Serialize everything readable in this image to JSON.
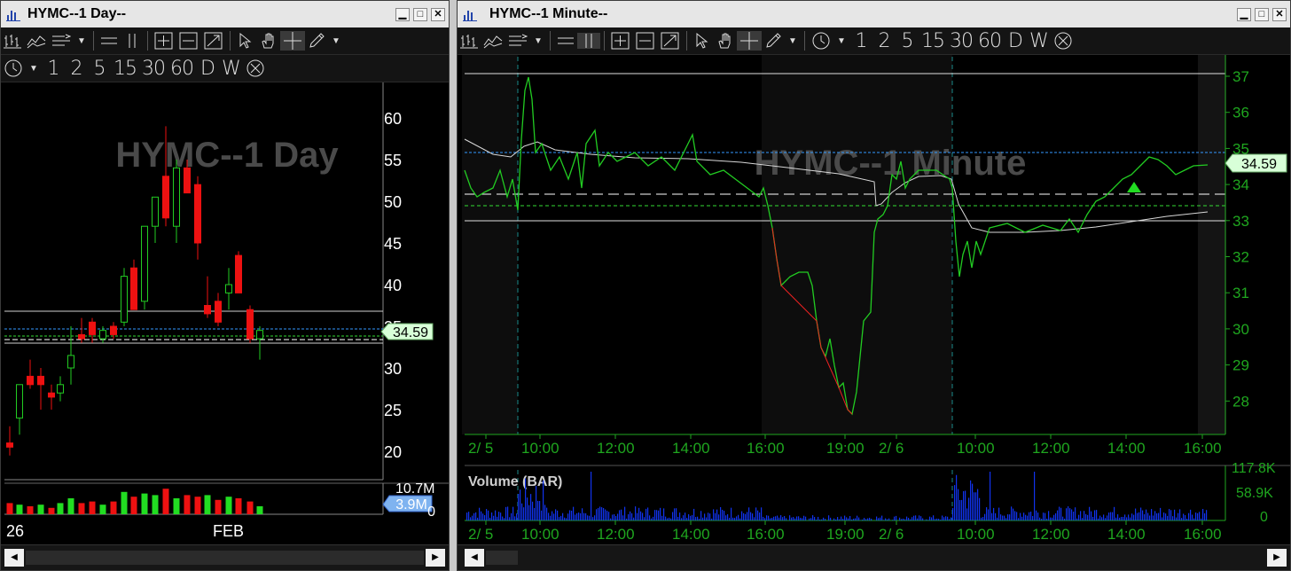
{
  "daily": {
    "title": "HYMC--1 Day--",
    "watermark": "HYMC--1 Day",
    "price_tag": "34.59",
    "y_ticks": [
      "60",
      "55",
      "50",
      "45",
      "40",
      "35",
      "30",
      "25",
      "20"
    ],
    "volume_top_label": "10.7M",
    "volume_tag": "3.9M",
    "volume_zero": "0",
    "x_labels": [
      "26",
      "FEB"
    ],
    "timeframes": [
      "1",
      "2",
      "5",
      "15",
      "30",
      "60",
      "D",
      "W"
    ]
  },
  "minute": {
    "title": "HYMC--1 Minute--",
    "watermark": "HYMC--1 Minute",
    "price_tag": "34.59",
    "y_ticks": [
      "37",
      "36",
      "35",
      "34",
      "33",
      "32",
      "31",
      "30",
      "29",
      "28"
    ],
    "x_labels": [
      "2/ 5",
      "10:00",
      "12:00",
      "14:00",
      "16:00",
      "19:00",
      "2/ 6",
      "10:00",
      "12:00",
      "14:00",
      "16:00"
    ],
    "volume_title": "Volume (BAR)",
    "volume_ticks": [
      "117.8K",
      "58.9K",
      "0"
    ],
    "timeframes": [
      "1",
      "2",
      "5",
      "15",
      "30",
      "60",
      "D",
      "W"
    ]
  },
  "window_buttons": [
    "▁",
    "□",
    "✕"
  ],
  "scroll": {
    "left": "◀",
    "right": "▶"
  },
  "icons": [
    "bar-chart-icon",
    "line-chart-icon",
    "studies-icon",
    "dropdown-icon",
    "hline-icon",
    "vline-icon",
    "zoom-in-icon",
    "zoom-out-icon",
    "zoom-fit-icon",
    "pointer-icon",
    "hand-icon",
    "crosshair-icon",
    "pencil-icon",
    "clock-icon",
    "close-circle-icon"
  ],
  "colors": {
    "up": "#22cc22",
    "down": "#ee1111",
    "axis_green": "#1fa61f",
    "volume_blue": "#1133ee",
    "price_tag_bg": "#d8ffd8",
    "volume_tag_bg": "#7fb3f0",
    "blue_dash": "#3399ff",
    "green_dash": "#33dd33"
  }
}
